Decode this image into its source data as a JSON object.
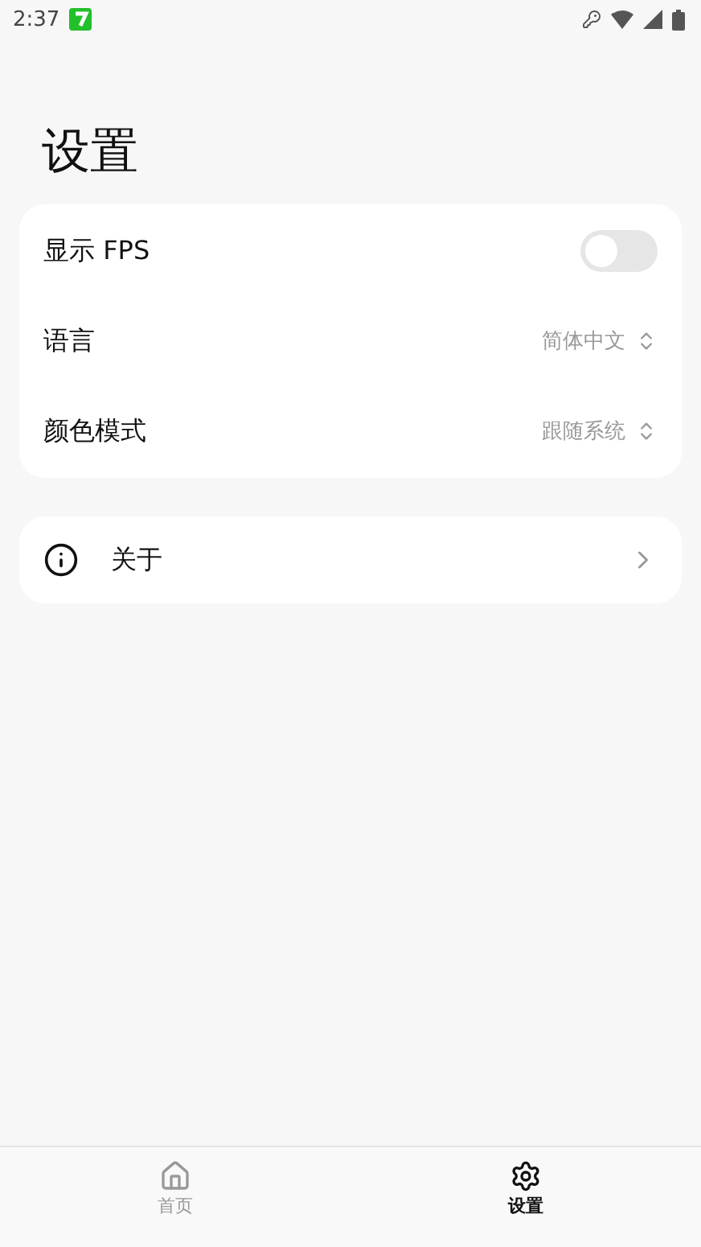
{
  "status_bar": {
    "time": "2:37"
  },
  "title": "设置",
  "settings_group": [
    {
      "kind": "toggle",
      "label": "显示 FPS",
      "on": false
    },
    {
      "kind": "select",
      "label": "语言",
      "value": "简体中文"
    },
    {
      "kind": "select",
      "label": "颜色模式",
      "value": "跟随系统"
    }
  ],
  "about": {
    "label": "关于"
  },
  "bottom_nav": [
    {
      "kind": "home",
      "label": "首页",
      "selected": false
    },
    {
      "kind": "settings",
      "label": "设置",
      "selected": true
    }
  ]
}
